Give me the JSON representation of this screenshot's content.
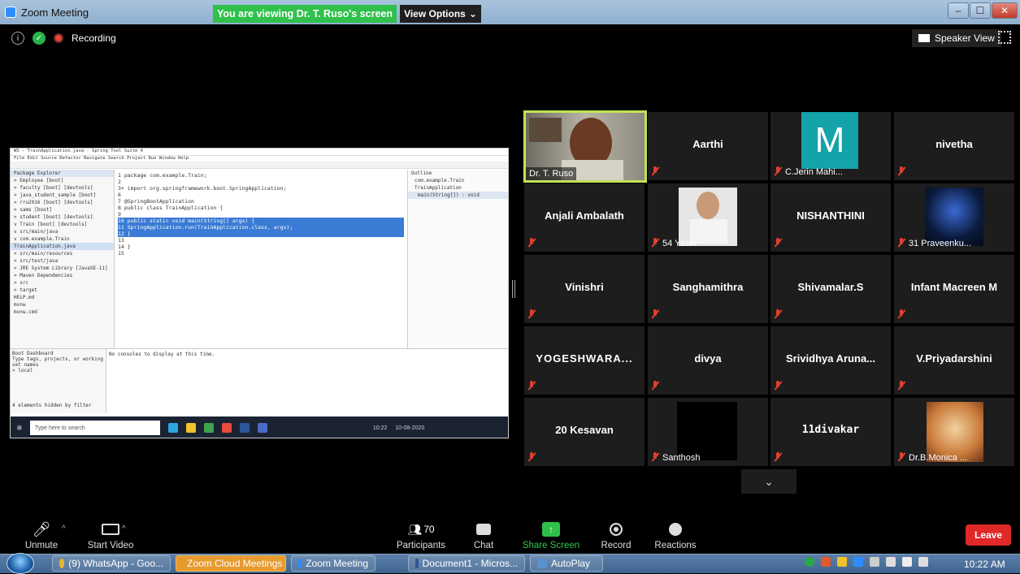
{
  "window": {
    "title": "Zoom Meeting",
    "viewing_banner": "You are viewing Dr. T. Ruso's screen",
    "view_options": "View Options",
    "min_glyph": "–",
    "max_glyph": "☐",
    "close_glyph": "✕"
  },
  "status": {
    "info_glyph": "i",
    "shield_glyph": "✓",
    "recording_label": "Recording",
    "speaker_view_label": "Speaker View"
  },
  "shared_screen": {
    "eclipse_title": "WS - TrainApplication.java - Spring Tool Suite 4",
    "menu": "File  Edit  Source  Refactor  Navigate  Search  Project  Run  Window  Help",
    "package_explorer": [
      "Package Explorer",
      "> Employee [boot]",
      "> faculty [boot] [devtools]",
      "> java_student_sample [boot]",
      "> rru2016 [boot] [devtools]",
      "> sams [boot]",
      "> student [boot] [devtools]",
      "v Train [boot] [devtools]",
      "  v src/main/java",
      "    v com.example.Train",
      "      TrainApplication.java",
      "  > src/main/resources",
      "  > src/test/java",
      "  > JRE System Library [JavaSE-11]",
      "  > Maven Dependencies",
      "  > src",
      "  > target",
      "    HELP.md",
      "    mvnw",
      "    mvnw.cmd"
    ],
    "code_lines": [
      "1  package com.example.Train;",
      "2",
      "3+ import org.springframework.boot.SpringApplication;",
      "6",
      "7  @SpringBootApplication",
      "8  public class TrainApplication {",
      "9",
      "10     public static void main(String[] args) {",
      "11         SpringApplication.run(TrainApplication.class, args);",
      "12     }",
      "13",
      "14 }",
      "15"
    ],
    "outline": [
      "Outline",
      "com.example.Train",
      "TrainApplication",
      "main(String[]) : void"
    ],
    "boot_dashboard": [
      "Boot Dashboard",
      "Type tags, projects, or working set names",
      "> local",
      "4 elements hidden by filter"
    ],
    "console_text": "No consoles to display at this time.",
    "taskbar_search": "Type here to search",
    "taskbar_time": "10:22",
    "taskbar_date": "10-08-2020"
  },
  "participants_tiles": [
    {
      "name": "Dr. T. Ruso",
      "style": "video"
    },
    {
      "name": "Aarthi",
      "style": "center"
    },
    {
      "name": "C.Jerin Mahi...",
      "style": "avatar-m",
      "avatar_letter": "M"
    },
    {
      "name": "nivetha",
      "style": "center"
    },
    {
      "name": "Anjali Ambalath",
      "style": "center"
    },
    {
      "name": "54 Yaser",
      "style": "photo"
    },
    {
      "name": "NISHANTHINI",
      "style": "center"
    },
    {
      "name": "31 Praveenku...",
      "style": "photo"
    },
    {
      "name": "Vinishri",
      "style": "center"
    },
    {
      "name": "Sanghamithra",
      "style": "center"
    },
    {
      "name": "Shivamalar.S",
      "style": "center"
    },
    {
      "name": "Infant Macreen M",
      "style": "center"
    },
    {
      "name": "YOGESHWARA...",
      "style": "center"
    },
    {
      "name": "divya",
      "style": "center"
    },
    {
      "name": "Srividhya  Aruna...",
      "style": "center"
    },
    {
      "name": "V.Priyadarshini",
      "style": "center"
    },
    {
      "name": "20 Kesavan",
      "style": "center"
    },
    {
      "name": "Santhosh",
      "style": "photo"
    },
    {
      "name": "11divakar",
      "style": "center"
    },
    {
      "name": "Dr.B.Monica ...",
      "style": "photo"
    }
  ],
  "toolbar": {
    "unmute": "Unmute",
    "start_video": "Start Video",
    "participants": "Participants",
    "participants_count": "70",
    "chat": "Chat",
    "share_screen": "Share Screen",
    "record": "Record",
    "reactions": "Reactions",
    "leave": "Leave"
  },
  "taskbar": {
    "items": [
      "(9) WhatsApp - Goo...",
      "Zoom Cloud Meetings",
      "Zoom Meeting",
      "Document1 - Micros...",
      "AutoPlay"
    ],
    "clock": "10:22 AM"
  },
  "colors": {
    "active_speaker_border": "#c1e354",
    "banner_green": "#30c04c",
    "leave_red": "#e02828",
    "mute_red": "#e04030"
  }
}
